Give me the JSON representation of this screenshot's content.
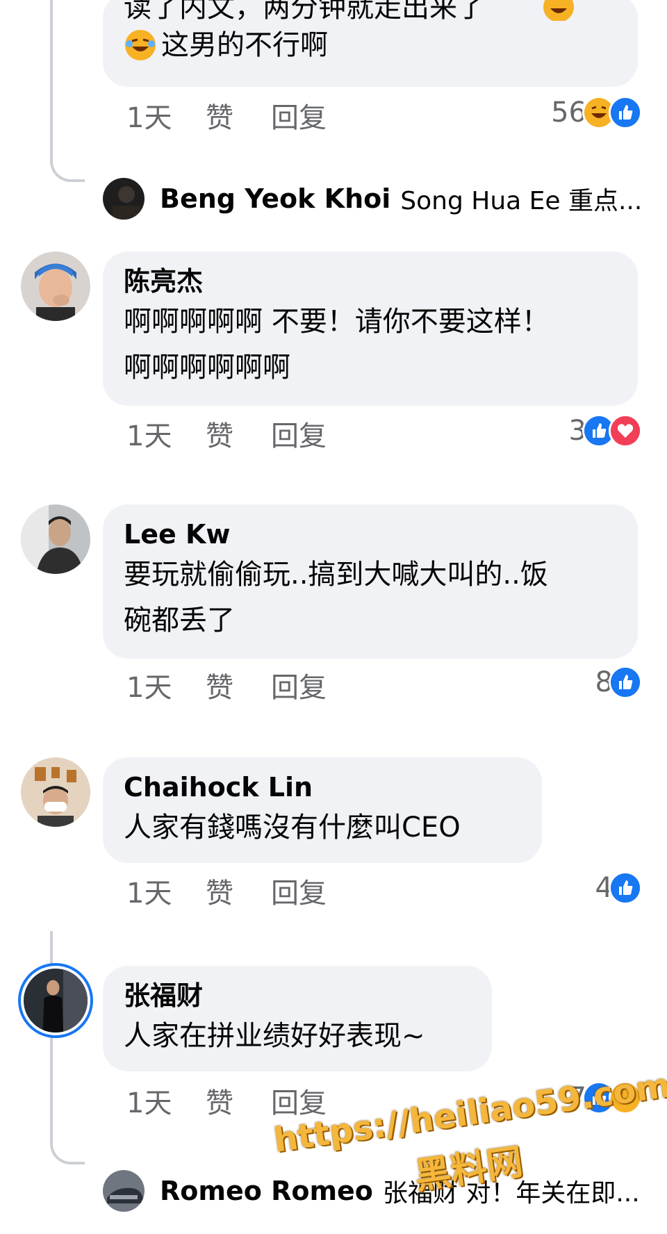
{
  "comments": [
    {
      "text": [
        "读了内文，两分钟就走出来了",
        "这男的不行啊"
      ],
      "time": "1天",
      "like": "赞",
      "reply": "回复",
      "reaction_count": "56",
      "reactions": [
        "haha-icon",
        "like-icon"
      ]
    },
    {
      "name": "陈亮杰",
      "text": [
        "啊啊啊啊啊 不要！请你不要这样！",
        "啊啊啊啊啊啊"
      ],
      "time": "1天",
      "like": "赞",
      "reply": "回复",
      "reaction_count": "3",
      "reactions": [
        "like-icon",
        "love-icon"
      ]
    },
    {
      "name": "Lee Kw",
      "text": [
        "要玩就偷偷玩..搞到大喊大叫的..饭",
        "碗都丢了"
      ],
      "time": "1天",
      "like": "赞",
      "reply": "回复",
      "reaction_count": "8",
      "reactions": [
        "like-icon"
      ]
    },
    {
      "name": "Chaihock Lin",
      "text": [
        "人家有錢嗎沒有什麼叫CEO"
      ],
      "time": "1天",
      "like": "赞",
      "reply": "回复",
      "reaction_count": "4",
      "reactions": [
        "like-icon"
      ]
    },
    {
      "name": "张福财",
      "text": [
        "人家在拼业绩好好表现~"
      ],
      "time": "1天",
      "like": "赞",
      "reply": "回复",
      "reaction_count": "7",
      "reactions": [
        "like-icon",
        "haha-icon"
      ]
    }
  ],
  "replies": [
    {
      "name": "Beng Yeok  Khoi",
      "text": "Song Hua Ee 重点..."
    },
    {
      "name": "Romeo Romeo",
      "text": "张福财 对！年关在即..."
    }
  ],
  "watermark": {
    "url": "https://heiliao59.com",
    "label": "黑料网"
  },
  "colors": {
    "like": "#1877f2",
    "love": "#f33e58",
    "haha": "#f7b125",
    "bubble": "#f0f2f5",
    "meta": "#65676b"
  }
}
